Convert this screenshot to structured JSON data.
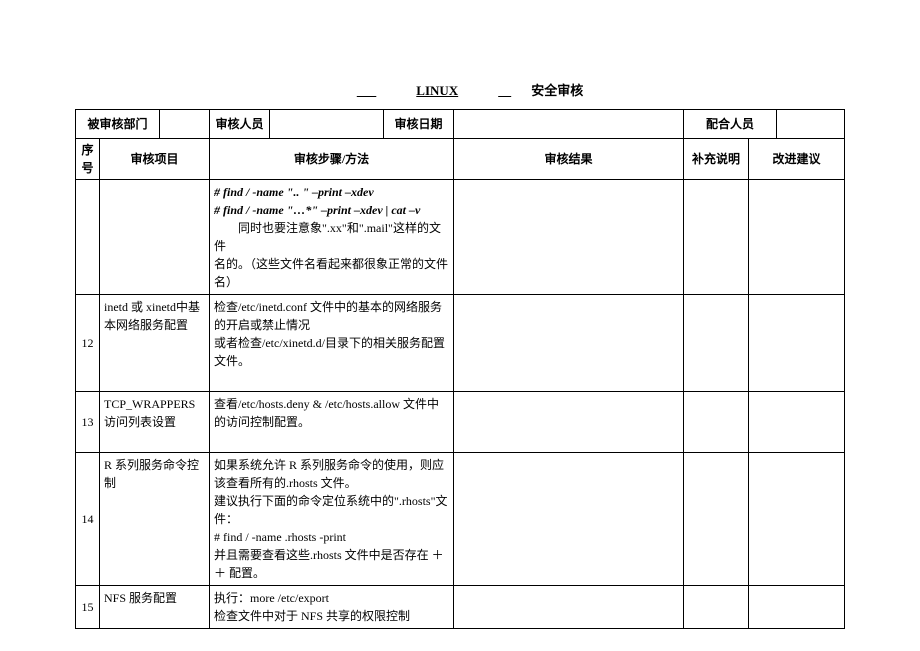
{
  "title": {
    "prefix_blank": " ",
    "linux": "LINUX",
    "mid_blank": " ",
    "suffix": "安全审核"
  },
  "meta": {
    "dept_label": "被审核部门",
    "auditor_label": "审核人员",
    "date_label": "审核日期",
    "coop_label": "配合人员"
  },
  "headers": {
    "seq": "序号",
    "item": "审核项目",
    "steps": "审核步骤/方法",
    "result": "审核结果",
    "supp": "补充说明",
    "imp": "改进建议"
  },
  "rows": {
    "r0_step_l1": "# find / -name \".. \" –print –xdev",
    "r0_step_l2": "# find / -name \"…*\" –print –xdev | cat –v",
    "r0_step_l3_a": "同时也要注意象\".xx\"和\".mail\"这样的文件",
    "r0_step_l3_b": "名的。（这些文件名看起来都很象正常的文件名）",
    "r12_seq": "12",
    "r12_item": "inetd 或 xinetd中基本网络服务配置",
    "r12_step_a": "检查/etc/inetd.conf 文件中的基本的网络服务的开启或禁止情况",
    "r12_step_b": "或者检查/etc/xinetd.d/目录下的相关服务配置文件。",
    "r13_seq": "13",
    "r13_item": "TCP_WRAPPERS 访问列表设置",
    "r13_step": "查看/etc/hosts.deny & /etc/hosts.allow 文件中的访问控制配置。",
    "r14_seq": "14",
    "r14_item": "R 系列服务命令控制",
    "r14_step_a": "如果系统允许 R 系列服务命令的使用，则应该查看所有的.rhosts 文件。",
    "r14_step_b": "建议执行下面的命令定位系统中的\".rhosts\"文件：",
    "r14_step_c": "# find / -name .rhosts -print",
    "r14_step_d": "并且需要查看这些.rhosts 文件中是否存在 ＋＋ 配置。",
    "r15_seq": "15",
    "r15_item": "NFS 服务配置",
    "r15_step_a": "执行：more /etc/export",
    "r15_step_b": "检查文件中对于 NFS 共享的权限控制"
  }
}
